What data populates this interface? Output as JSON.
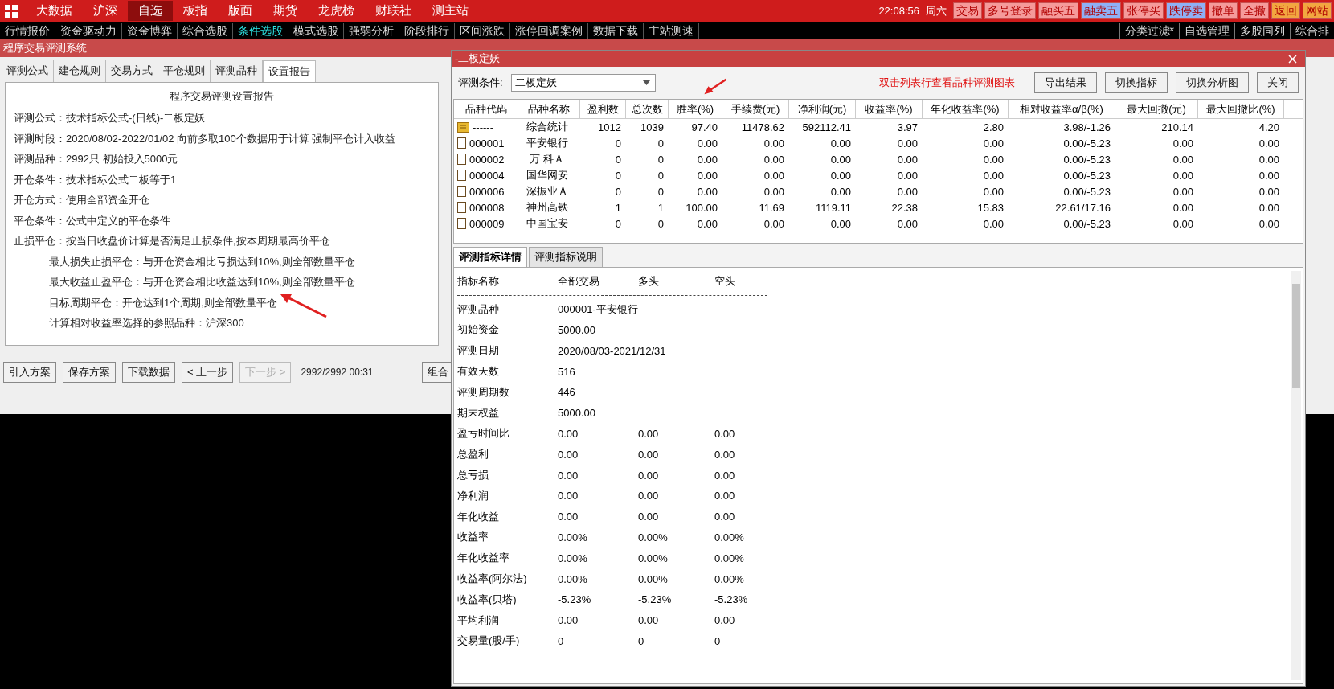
{
  "menu_bar": {
    "items": [
      {
        "label": "大数据",
        "selected": false
      },
      {
        "label": "沪深",
        "selected": false
      },
      {
        "label": "自选",
        "selected": true
      },
      {
        "label": "板指",
        "selected": false
      },
      {
        "label": "版面",
        "selected": false
      },
      {
        "label": "期货",
        "selected": false
      },
      {
        "label": "龙虎榜",
        "selected": false
      },
      {
        "label": "财联社",
        "selected": false
      },
      {
        "label": "测主站",
        "selected": false
      }
    ],
    "time": "22:08:56",
    "weekday": "周六",
    "buttons": [
      {
        "label": "交易",
        "color": "#f59a9a"
      },
      {
        "label": "多号登录",
        "color": "#f59a9a"
      },
      {
        "label": "融买五",
        "color": "#f59a9a"
      },
      {
        "label": "融卖五",
        "color": "#8fb0f5"
      },
      {
        "label": "张停买",
        "color": "#f59a9a"
      },
      {
        "label": "跌停卖",
        "color": "#8fb0f5"
      },
      {
        "label": "撤单",
        "color": "#f59a9a"
      },
      {
        "label": "全撤",
        "color": "#f59a9a"
      },
      {
        "label": "返回",
        "color": "#f2a640"
      },
      {
        "label": "网站",
        "color": "#f2a640"
      }
    ]
  },
  "function_bar": {
    "tabs": [
      {
        "label": "行情报价",
        "selected": false
      },
      {
        "label": "资金驱动力",
        "selected": false
      },
      {
        "label": "资金博弈",
        "selected": false
      },
      {
        "label": "综合选股",
        "selected": false
      },
      {
        "label": "条件选股",
        "selected": true
      },
      {
        "label": "模式选股",
        "selected": false
      },
      {
        "label": "强弱分析",
        "selected": false
      },
      {
        "label": "阶段排行",
        "selected": false
      },
      {
        "label": "区间涨跌",
        "selected": false
      },
      {
        "label": "涨停回调案例",
        "selected": false
      },
      {
        "label": "数据下载",
        "selected": false
      },
      {
        "label": "主站测速",
        "selected": false
      }
    ],
    "right_items": [
      "分类过滤*",
      "自选管理",
      "多股同列",
      "综合排"
    ]
  },
  "main_window": {
    "title": "程序交易评测系统",
    "tabs": [
      {
        "label": "评测公式",
        "selected": false
      },
      {
        "label": "建仓规则",
        "selected": false
      },
      {
        "label": "交易方式",
        "selected": false
      },
      {
        "label": "平仓规则",
        "selected": false
      },
      {
        "label": "评测品种",
        "selected": false
      },
      {
        "label": "设置报告",
        "selected": true
      }
    ],
    "report": {
      "title": "程序交易评测设置报告",
      "lines": [
        {
          "text": "评测公式：技术指标公式-(日线)-二板定妖",
          "indented": false
        },
        {
          "text": "评测时段：2020/08/02-2022/01/02 向前多取100个数据用于计算 强制平仓计入收益",
          "indented": false
        },
        {
          "text": "评测品种：2992只 初始投入5000元",
          "indented": false
        },
        {
          "text": "开仓条件：技术指标公式二板等于1",
          "indented": false
        },
        {
          "text": "开仓方式：使用全部资金开仓",
          "indented": false
        },
        {
          "text": "平仓条件：公式中定义的平仓条件",
          "indented": false
        },
        {
          "text": "止损平仓：按当日收盘价计算是否满足止损条件,按本周期最高价平仓",
          "indented": false
        },
        {
          "text": "最大损失止损平仓：与开仓资金相比亏损达到10%,则全部数量平仓",
          "indented": true
        },
        {
          "text": "最大收益止盈平仓：与开仓资金相比收益达到10%,则全部数量平仓",
          "indented": true
        },
        {
          "text": "目标周期平仓：开仓达到1个周期,则全部数量平仓",
          "indented": true
        },
        {
          "text": "计算相对收益率选择的参照品种：沪深300",
          "indented": true
        }
      ]
    },
    "buttons": [
      {
        "label": "引入方案",
        "disabled": false
      },
      {
        "label": "保存方案",
        "disabled": false
      },
      {
        "label": "下载数据",
        "disabled": false
      },
      {
        "label": "< 上一步",
        "disabled": false
      },
      {
        "label": "下一步 >",
        "disabled": true
      }
    ],
    "status": "2992/2992  00:31",
    "cut_button": "组合"
  },
  "result_window": {
    "title": "-二板定妖",
    "condition_label": "评测条件:",
    "condition_value": "二板定妖",
    "hint": "双击列表行查看品种评测图表",
    "buttons": [
      "导出结果",
      "切换指标",
      "切换分析图",
      "关闭"
    ],
    "table": {
      "columns": [
        "品种代码",
        "品种名称",
        "盈利数",
        "总次数",
        "胜率(%)",
        "手续费(元)",
        "净利润(元)",
        "收益率(%)",
        "年化收益率(%)",
        "相对收益率α/β(%)",
        "最大回撤(元)",
        "最大回撤比(%)"
      ],
      "rows": [
        {
          "kind": "summary",
          "cells": [
            "------",
            "综合统计",
            "1012",
            "1039",
            "97.40",
            "11478.62",
            "592112.41",
            "3.97",
            "2.80",
            "3.98/-1.26",
            "210.14",
            "4.20"
          ]
        },
        {
          "kind": "stock",
          "cells": [
            "000001",
            "平安银行",
            "0",
            "0",
            "0.00",
            "0.00",
            "0.00",
            "0.00",
            "0.00",
            "0.00/-5.23",
            "0.00",
            "0.00"
          ]
        },
        {
          "kind": "stock",
          "cells": [
            "000002",
            "万 科Ａ",
            "0",
            "0",
            "0.00",
            "0.00",
            "0.00",
            "0.00",
            "0.00",
            "0.00/-5.23",
            "0.00",
            "0.00"
          ]
        },
        {
          "kind": "stock",
          "cells": [
            "000004",
            "国华网安",
            "0",
            "0",
            "0.00",
            "0.00",
            "0.00",
            "0.00",
            "0.00",
            "0.00/-5.23",
            "0.00",
            "0.00"
          ]
        },
        {
          "kind": "stock",
          "cells": [
            "000006",
            "深振业Ａ",
            "0",
            "0",
            "0.00",
            "0.00",
            "0.00",
            "0.00",
            "0.00",
            "0.00/-5.23",
            "0.00",
            "0.00"
          ]
        },
        {
          "kind": "stock",
          "cells": [
            "000008",
            "神州高铁",
            "1",
            "1",
            "100.00",
            "11.69",
            "1119.11",
            "22.38",
            "15.83",
            "22.61/17.16",
            "0.00",
            "0.00"
          ]
        },
        {
          "kind": "stock",
          "cells": [
            "000009",
            "中国宝安",
            "0",
            "0",
            "0.00",
            "0.00",
            "0.00",
            "0.00",
            "0.00",
            "0.00/-5.23",
            "0.00",
            "0.00"
          ]
        }
      ]
    },
    "detail_tabs": [
      {
        "label": "评测指标详情",
        "selected": true
      },
      {
        "label": "评测指标说明",
        "selected": false
      }
    ],
    "detail": {
      "columns": [
        "指标名称",
        "全部交易",
        "多头",
        "空头"
      ],
      "rows": [
        {
          "name": "评测品种",
          "values": [
            "000001-平安银行"
          ]
        },
        {
          "name": "初始资金",
          "values": [
            "5000.00"
          ]
        },
        {
          "name": "评测日期",
          "values": [
            "2020/08/03-2021/12/31"
          ]
        },
        {
          "name": "有效天数",
          "values": [
            "516"
          ]
        },
        {
          "name": "评测周期数",
          "values": [
            "446"
          ]
        },
        {
          "name": "期末权益",
          "values": [
            "5000.00"
          ]
        },
        {
          "name": "盈亏时间比",
          "values": [
            "0.00",
            "0.00",
            "0.00"
          ]
        },
        {
          "name": "总盈利",
          "values": [
            "0.00",
            "0.00",
            "0.00"
          ]
        },
        {
          "name": "总亏损",
          "values": [
            "0.00",
            "0.00",
            "0.00"
          ]
        },
        {
          "name": "净利润",
          "values": [
            "0.00",
            "0.00",
            "0.00"
          ]
        },
        {
          "name": "年化收益",
          "values": [
            "0.00",
            "0.00",
            "0.00"
          ]
        },
        {
          "name": "收益率",
          "values": [
            "0.00%",
            "0.00%",
            "0.00%"
          ]
        },
        {
          "name": "年化收益率",
          "values": [
            "0.00%",
            "0.00%",
            "0.00%"
          ]
        },
        {
          "name": "收益率(阿尔法)",
          "values": [
            "0.00%",
            "0.00%",
            "0.00%"
          ]
        },
        {
          "name": "收益率(贝塔)",
          "values": [
            "-5.23%",
            "-5.23%",
            "-5.23%"
          ]
        },
        {
          "name": "平均利润",
          "values": [
            "0.00",
            "0.00",
            "0.00"
          ]
        },
        {
          "name": "交易量(股/手)",
          "values": [
            "0",
            "0",
            "0"
          ]
        }
      ]
    }
  }
}
